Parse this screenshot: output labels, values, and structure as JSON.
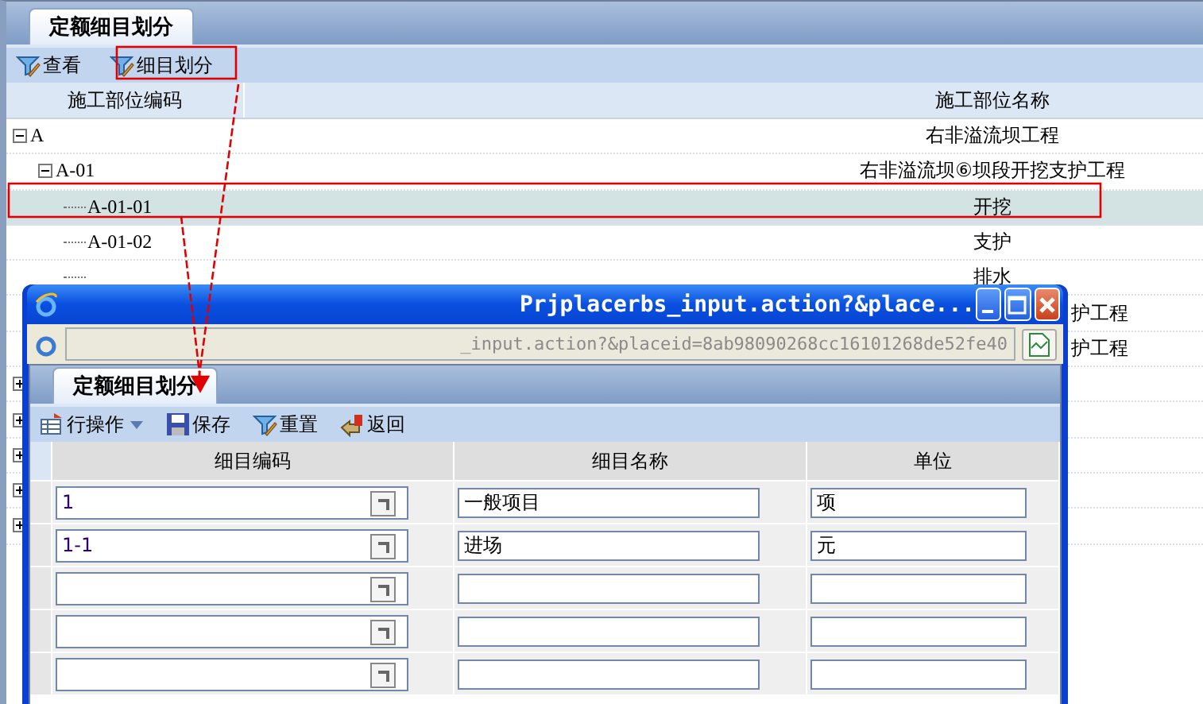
{
  "main_tab": {
    "label": "定额细目划分",
    "selected": true
  },
  "toolbar": [
    {
      "label": "查看"
    },
    {
      "label": "细目划分"
    }
  ],
  "tree": {
    "columns": [
      "施工部位编码",
      "施工部位名称"
    ],
    "rows": [
      {
        "code": "A",
        "name": "右非溢流坝工程",
        "expanded": true,
        "selected": false,
        "children": [
          {
            "code": "A-01",
            "name": "右非溢流坝⑥坝段开挖支护工程",
            "expanded": true,
            "selected": false,
            "children": [
              {
                "code": "A-01-01",
                "name": "开挖",
                "selected": true
              },
              {
                "code": "A-01-02",
                "name": "支护",
                "selected": false
              },
              {
                "name": "排水",
                "selected": false
              },
              {
                "name": "护工程",
                "kind": "tail",
                "selected": false
              },
              {
                "name": "护工程",
                "kind": "tail",
                "selected": false
              }
            ]
          }
        ]
      },
      {
        "expanded": false,
        "selected": false
      },
      {
        "expanded": false,
        "selected": false
      },
      {
        "expanded": false,
        "selected": false
      },
      {
        "expanded": false,
        "selected": false
      },
      {
        "expanded": false,
        "selected": false
      }
    ]
  },
  "popup": {
    "title": "Prjplacerbs_input.action?&place...",
    "address": "_input.action?&placeid=8ab98090268cc16101268de52fe40",
    "tab": {
      "label": "定额细目划分",
      "selected": true
    },
    "toolbar": [
      {
        "label": "行操作",
        "kind": "menu"
      },
      {
        "label": "保存",
        "kind": "save"
      },
      {
        "label": "重置",
        "kind": "reset"
      },
      {
        "label": "返回",
        "kind": "back"
      }
    ],
    "columns": [
      "细目编码",
      "细目名称",
      "单位"
    ],
    "rows": [
      {
        "code": "1",
        "name": "一般项目",
        "unit": "项"
      },
      {
        "code": "1-1",
        "name": "进场",
        "unit": "元"
      },
      {},
      {},
      {}
    ]
  }
}
